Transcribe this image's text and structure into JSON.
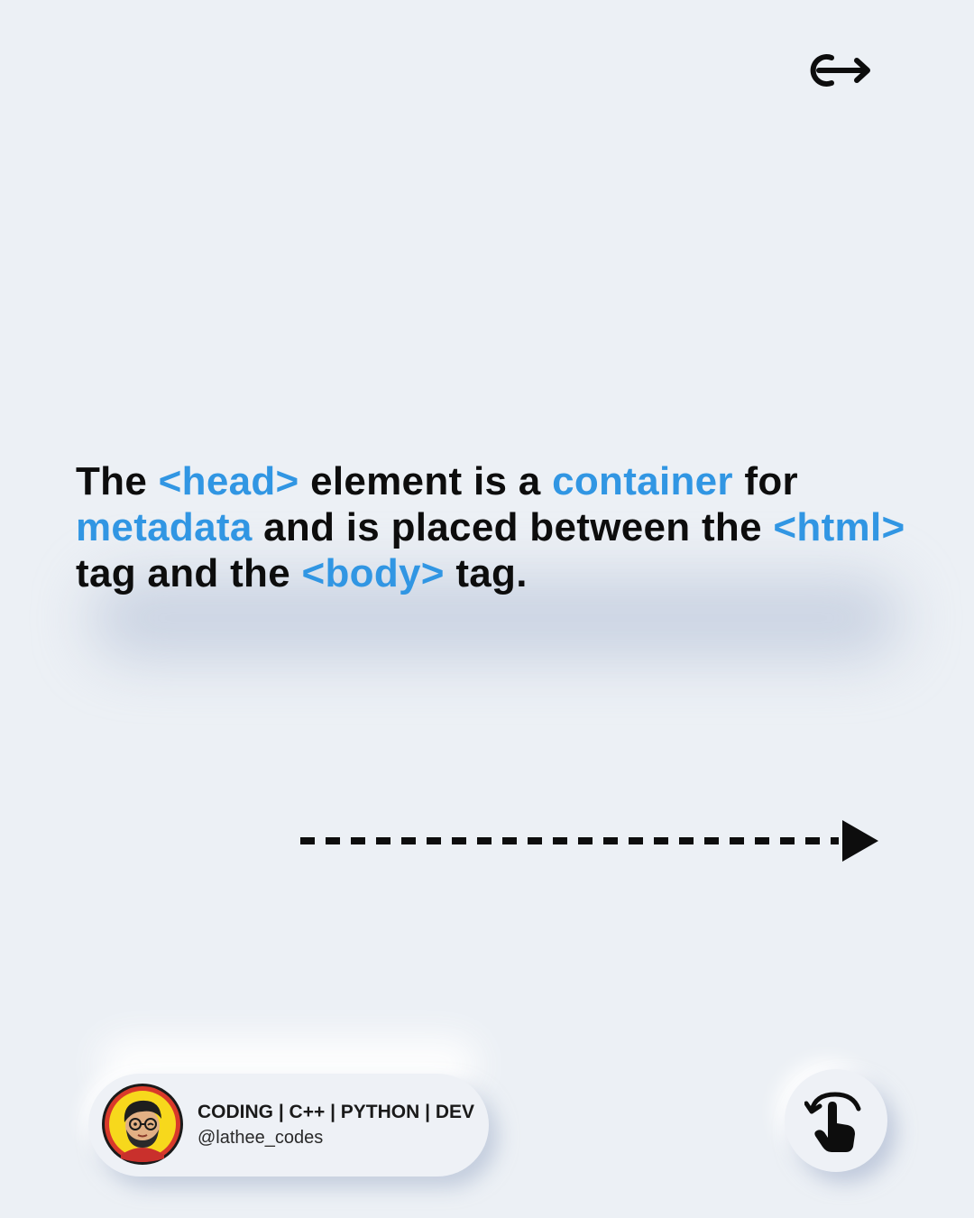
{
  "main_text": {
    "seg1": "The ",
    "seg2": "<head>",
    "seg3": " element is a ",
    "seg4": "container",
    "seg5": " for ",
    "seg6": "metadata",
    "seg7": " and is placed between the ",
    "seg8": "<html>",
    "seg9": " tag and the ",
    "seg10": "<body>",
    "seg11": " tag."
  },
  "profile": {
    "title": "CODING | C++ | PYTHON | DEV",
    "handle": "@lathee_codes"
  },
  "icons": {
    "top_right": "share-arrow-icon",
    "avatar": "cartoon-avatar",
    "next": "dotted-arrow-right-icon",
    "swipe": "swipe-hand-icon"
  },
  "colors": {
    "background": "#ecf0f5",
    "highlight": "#3196e3",
    "text": "#0d0d0d"
  }
}
